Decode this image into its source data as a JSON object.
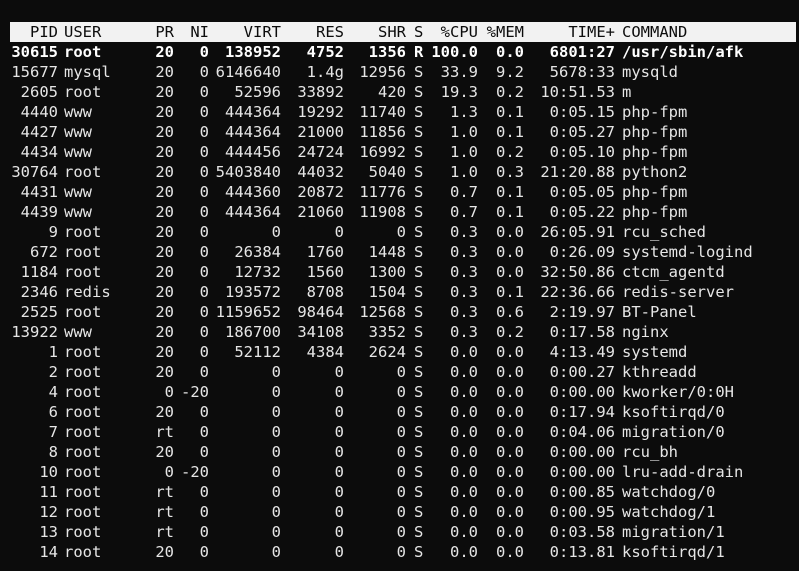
{
  "window": {
    "background": "#0c0c0c",
    "foreground": "#e6e6e6",
    "header_background": "#f2f2f2",
    "header_foreground": "#0c0c0c"
  },
  "columns": {
    "pid": "PID",
    "user": "USER",
    "pr": "PR",
    "ni": "NI",
    "virt": "VIRT",
    "res": "RES",
    "shr": "SHR",
    "s": "S",
    "cpu": "%CPU",
    "mem": "%MEM",
    "time": "TIME+",
    "command": "COMMAND"
  },
  "processes": [
    {
      "pid": "30615",
      "user": "root",
      "pr": "20",
      "ni": "0",
      "virt": "138952",
      "res": "4752",
      "shr": "1356",
      "s": "R",
      "cpu": "100.0",
      "mem": "0.0",
      "time": "6801:27",
      "command": "/usr/sbin/afk",
      "highlight": true
    },
    {
      "pid": "15677",
      "user": "mysql",
      "pr": "20",
      "ni": "0",
      "virt": "6146640",
      "res": "1.4g",
      "shr": "12956",
      "s": "S",
      "cpu": "33.9",
      "mem": "9.2",
      "time": "5678:33",
      "command": "mysqld"
    },
    {
      "pid": "2605",
      "user": "root",
      "pr": "20",
      "ni": "0",
      "virt": "52596",
      "res": "33892",
      "shr": "420",
      "s": "S",
      "cpu": "19.3",
      "mem": "0.2",
      "time": "10:51.53",
      "command": "m"
    },
    {
      "pid": "4440",
      "user": "www",
      "pr": "20",
      "ni": "0",
      "virt": "444364",
      "res": "19292",
      "shr": "11740",
      "s": "S",
      "cpu": "1.3",
      "mem": "0.1",
      "time": "0:05.15",
      "command": "php-fpm"
    },
    {
      "pid": "4427",
      "user": "www",
      "pr": "20",
      "ni": "0",
      "virt": "444364",
      "res": "21000",
      "shr": "11856",
      "s": "S",
      "cpu": "1.0",
      "mem": "0.1",
      "time": "0:05.27",
      "command": "php-fpm"
    },
    {
      "pid": "4434",
      "user": "www",
      "pr": "20",
      "ni": "0",
      "virt": "444456",
      "res": "24724",
      "shr": "16992",
      "s": "S",
      "cpu": "1.0",
      "mem": "0.2",
      "time": "0:05.10",
      "command": "php-fpm"
    },
    {
      "pid": "30764",
      "user": "root",
      "pr": "20",
      "ni": "0",
      "virt": "5403840",
      "res": "44032",
      "shr": "5040",
      "s": "S",
      "cpu": "1.0",
      "mem": "0.3",
      "time": "21:20.88",
      "command": "python2"
    },
    {
      "pid": "4431",
      "user": "www",
      "pr": "20",
      "ni": "0",
      "virt": "444360",
      "res": "20872",
      "shr": "11776",
      "s": "S",
      "cpu": "0.7",
      "mem": "0.1",
      "time": "0:05.05",
      "command": "php-fpm"
    },
    {
      "pid": "4439",
      "user": "www",
      "pr": "20",
      "ni": "0",
      "virt": "444364",
      "res": "21060",
      "shr": "11908",
      "s": "S",
      "cpu": "0.7",
      "mem": "0.1",
      "time": "0:05.22",
      "command": "php-fpm"
    },
    {
      "pid": "9",
      "user": "root",
      "pr": "20",
      "ni": "0",
      "virt": "0",
      "res": "0",
      "shr": "0",
      "s": "S",
      "cpu": "0.3",
      "mem": "0.0",
      "time": "26:05.91",
      "command": "rcu_sched"
    },
    {
      "pid": "672",
      "user": "root",
      "pr": "20",
      "ni": "0",
      "virt": "26384",
      "res": "1760",
      "shr": "1448",
      "s": "S",
      "cpu": "0.3",
      "mem": "0.0",
      "time": "0:26.09",
      "command": "systemd-logind"
    },
    {
      "pid": "1184",
      "user": "root",
      "pr": "20",
      "ni": "0",
      "virt": "12732",
      "res": "1560",
      "shr": "1300",
      "s": "S",
      "cpu": "0.3",
      "mem": "0.0",
      "time": "32:50.86",
      "command": "ctcm_agentd"
    },
    {
      "pid": "2346",
      "user": "redis",
      "pr": "20",
      "ni": "0",
      "virt": "193572",
      "res": "8708",
      "shr": "1504",
      "s": "S",
      "cpu": "0.3",
      "mem": "0.1",
      "time": "22:36.66",
      "command": "redis-server"
    },
    {
      "pid": "2525",
      "user": "root",
      "pr": "20",
      "ni": "0",
      "virt": "1159652",
      "res": "98464",
      "shr": "12568",
      "s": "S",
      "cpu": "0.3",
      "mem": "0.6",
      "time": "2:19.97",
      "command": "BT-Panel"
    },
    {
      "pid": "13922",
      "user": "www",
      "pr": "20",
      "ni": "0",
      "virt": "186700",
      "res": "34108",
      "shr": "3352",
      "s": "S",
      "cpu": "0.3",
      "mem": "0.2",
      "time": "0:17.58",
      "command": "nginx"
    },
    {
      "pid": "1",
      "user": "root",
      "pr": "20",
      "ni": "0",
      "virt": "52112",
      "res": "4384",
      "shr": "2624",
      "s": "S",
      "cpu": "0.0",
      "mem": "0.0",
      "time": "4:13.49",
      "command": "systemd"
    },
    {
      "pid": "2",
      "user": "root",
      "pr": "20",
      "ni": "0",
      "virt": "0",
      "res": "0",
      "shr": "0",
      "s": "S",
      "cpu": "0.0",
      "mem": "0.0",
      "time": "0:00.27",
      "command": "kthreadd"
    },
    {
      "pid": "4",
      "user": "root",
      "pr": "0",
      "ni": "-20",
      "virt": "0",
      "res": "0",
      "shr": "0",
      "s": "S",
      "cpu": "0.0",
      "mem": "0.0",
      "time": "0:00.00",
      "command": "kworker/0:0H"
    },
    {
      "pid": "6",
      "user": "root",
      "pr": "20",
      "ni": "0",
      "virt": "0",
      "res": "0",
      "shr": "0",
      "s": "S",
      "cpu": "0.0",
      "mem": "0.0",
      "time": "0:17.94",
      "command": "ksoftirqd/0"
    },
    {
      "pid": "7",
      "user": "root",
      "pr": "rt",
      "ni": "0",
      "virt": "0",
      "res": "0",
      "shr": "0",
      "s": "S",
      "cpu": "0.0",
      "mem": "0.0",
      "time": "0:04.06",
      "command": "migration/0"
    },
    {
      "pid": "8",
      "user": "root",
      "pr": "20",
      "ni": "0",
      "virt": "0",
      "res": "0",
      "shr": "0",
      "s": "S",
      "cpu": "0.0",
      "mem": "0.0",
      "time": "0:00.00",
      "command": "rcu_bh"
    },
    {
      "pid": "10",
      "user": "root",
      "pr": "0",
      "ni": "-20",
      "virt": "0",
      "res": "0",
      "shr": "0",
      "s": "S",
      "cpu": "0.0",
      "mem": "0.0",
      "time": "0:00.00",
      "command": "lru-add-drain"
    },
    {
      "pid": "11",
      "user": "root",
      "pr": "rt",
      "ni": "0",
      "virt": "0",
      "res": "0",
      "shr": "0",
      "s": "S",
      "cpu": "0.0",
      "mem": "0.0",
      "time": "0:00.85",
      "command": "watchdog/0"
    },
    {
      "pid": "12",
      "user": "root",
      "pr": "rt",
      "ni": "0",
      "virt": "0",
      "res": "0",
      "shr": "0",
      "s": "S",
      "cpu": "0.0",
      "mem": "0.0",
      "time": "0:00.95",
      "command": "watchdog/1"
    },
    {
      "pid": "13",
      "user": "root",
      "pr": "rt",
      "ni": "0",
      "virt": "0",
      "res": "0",
      "shr": "0",
      "s": "S",
      "cpu": "0.0",
      "mem": "0.0",
      "time": "0:03.58",
      "command": "migration/1"
    },
    {
      "pid": "14",
      "user": "root",
      "pr": "20",
      "ni": "0",
      "virt": "0",
      "res": "0",
      "shr": "0",
      "s": "S",
      "cpu": "0.0",
      "mem": "0.0",
      "time": "0:13.81",
      "command": "ksoftirqd/1"
    }
  ]
}
